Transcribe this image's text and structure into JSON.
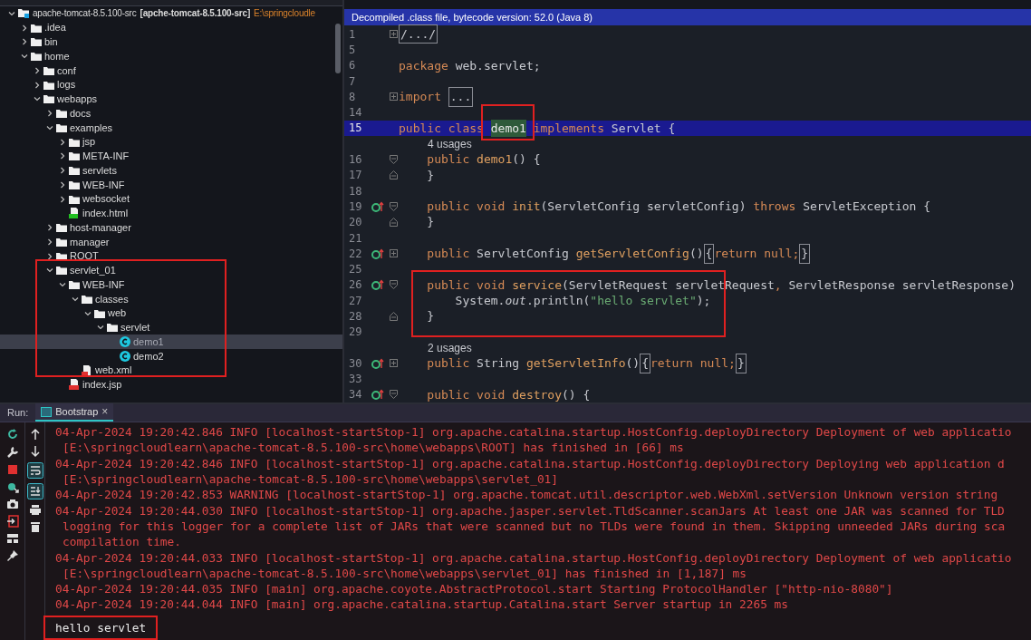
{
  "project_tree": {
    "label": "apache-tomcat-8.5.100-src",
    "module": "[apche-tomcat-8.5.100-src]",
    "path": "E:\\springcloudle",
    "kind": "module",
    "expanded": true,
    "selected": false,
    "children": [
      {
        "label": ".idea",
        "kind": "folder",
        "expanded": false,
        "selected": false
      },
      {
        "label": "bin",
        "kind": "folder",
        "expanded": false,
        "selected": false
      },
      {
        "label": "home",
        "kind": "folder",
        "expanded": true,
        "selected": false,
        "children": [
          {
            "label": "conf",
            "kind": "folder",
            "expanded": false,
            "selected": false
          },
          {
            "label": "logs",
            "kind": "folder",
            "expanded": false,
            "selected": false
          },
          {
            "label": "webapps",
            "kind": "folder",
            "expanded": true,
            "selected": false,
            "children": [
              {
                "label": "docs",
                "kind": "folder",
                "expanded": false,
                "selected": false
              },
              {
                "label": "examples",
                "kind": "folder",
                "expanded": true,
                "selected": false,
                "children": [
                  {
                    "label": "jsp",
                    "kind": "folder",
                    "expanded": false,
                    "selected": false
                  },
                  {
                    "label": "META-INF",
                    "kind": "folder",
                    "expanded": false,
                    "selected": false
                  },
                  {
                    "label": "servlets",
                    "kind": "folder",
                    "expanded": false,
                    "selected": false
                  },
                  {
                    "label": "WEB-INF",
                    "kind": "folder",
                    "expanded": false,
                    "selected": false
                  },
                  {
                    "label": "websocket",
                    "kind": "folder",
                    "expanded": false,
                    "selected": false
                  },
                  {
                    "label": "index.html",
                    "kind": "html",
                    "selected": false
                  }
                ]
              },
              {
                "label": "host-manager",
                "kind": "folder",
                "expanded": false,
                "selected": false
              },
              {
                "label": "manager",
                "kind": "folder",
                "expanded": false,
                "selected": false
              },
              {
                "label": "ROOT",
                "kind": "folder",
                "expanded": false,
                "selected": false
              },
              {
                "label": "servlet_01",
                "kind": "folder",
                "expanded": true,
                "selected": false,
                "children": [
                  {
                    "label": "WEB-INF",
                    "kind": "folder",
                    "expanded": true,
                    "selected": false,
                    "children": [
                      {
                        "label": "classes",
                        "kind": "folder",
                        "expanded": true,
                        "selected": false,
                        "children": [
                          {
                            "label": "web",
                            "kind": "folder",
                            "expanded": true,
                            "selected": false,
                            "children": [
                              {
                                "label": "servlet",
                                "kind": "folder",
                                "expanded": true,
                                "selected": false,
                                "children": [
                                  {
                                    "label": "demo1",
                                    "kind": "class",
                                    "selected": true
                                  },
                                  {
                                    "label": "demo2",
                                    "kind": "class",
                                    "selected": false
                                  }
                                ]
                              }
                            ]
                          }
                        ]
                      },
                      {
                        "label": "web.xml",
                        "kind": "xml",
                        "selected": false
                      }
                    ]
                  },
                  {
                    "label": "index.jsp",
                    "kind": "jsp",
                    "selected": false
                  }
                ]
              }
            ]
          }
        ]
      }
    ]
  },
  "editor": {
    "banner": "Decompiled .class file, bytecode version: 52.0 (Java 8)",
    "lines": [
      {
        "kind": "code",
        "number": "1",
        "folded": true,
        "segments": [
          {
            "text": "/.../",
            "kind": "fold"
          }
        ]
      },
      {
        "kind": "code",
        "number": "5"
      },
      {
        "kind": "code",
        "number": "6",
        "segments": [
          {
            "text": "package ",
            "kind": "kw"
          },
          {
            "text": "web.servlet;",
            "kind": "plain"
          }
        ]
      },
      {
        "kind": "code",
        "number": "7"
      },
      {
        "kind": "code",
        "number": "8",
        "folded": true,
        "segments": [
          {
            "text": "import ",
            "kind": "kw"
          },
          {
            "text": "...",
            "kind": "fold"
          }
        ]
      },
      {
        "kind": "code",
        "number": "14"
      },
      {
        "kind": "code",
        "number": "15",
        "selected": true,
        "segments": [
          {
            "text": "public class ",
            "kind": "kw"
          },
          {
            "text": "demo1",
            "kind": "match"
          },
          {
            "text": " implements ",
            "kind": "kw"
          },
          {
            "text": "Servlet {",
            "kind": "plain"
          }
        ]
      },
      {
        "kind": "usages",
        "text": "4 usages"
      },
      {
        "kind": "code",
        "number": "16",
        "fold_start": true,
        "segments": [
          {
            "text": "    public ",
            "kind": "kw"
          },
          {
            "text": "demo1",
            "kind": "fn"
          },
          {
            "text": "() {",
            "kind": "plain"
          }
        ]
      },
      {
        "kind": "code",
        "number": "17",
        "fold_end": true,
        "segments": [
          {
            "text": "    }",
            "kind": "plain"
          }
        ]
      },
      {
        "kind": "code",
        "number": "18"
      },
      {
        "kind": "code",
        "number": "19",
        "override": true,
        "fold_start": true,
        "segments": [
          {
            "text": "    public void ",
            "kind": "kw"
          },
          {
            "text": "init",
            "kind": "fn"
          },
          {
            "text": "(ServletConfig servletConfig) ",
            "kind": "plain"
          },
          {
            "text": "throws ",
            "kind": "kw"
          },
          {
            "text": "ServletException {",
            "kind": "plain"
          }
        ]
      },
      {
        "kind": "code",
        "number": "20",
        "fold_end": true,
        "segments": [
          {
            "text": "    }",
            "kind": "plain"
          }
        ]
      },
      {
        "kind": "code",
        "number": "21"
      },
      {
        "kind": "code",
        "number": "22",
        "override": true,
        "folded": true,
        "segments": [
          {
            "text": "    public ",
            "kind": "kw"
          },
          {
            "text": "ServletConfig ",
            "kind": "plain"
          },
          {
            "text": "getServletConfig",
            "kind": "fn"
          },
          {
            "text": "()",
            "kind": "plain"
          },
          {
            "text": "{",
            "kind": "fold"
          },
          {
            "text": "return null;",
            "kind": "kw"
          },
          {
            "text": "}",
            "kind": "fold"
          }
        ]
      },
      {
        "kind": "code",
        "number": "25"
      },
      {
        "kind": "code",
        "number": "26",
        "override": true,
        "fold_start": true,
        "segments": [
          {
            "text": "    public void ",
            "kind": "kw"
          },
          {
            "text": "service",
            "kind": "fn"
          },
          {
            "text": "(ServletRequest servletRequest",
            "kind": "plain"
          },
          {
            "text": ", ",
            "kind": "kw"
          },
          {
            "text": "ServletResponse servletResponse)",
            "kind": "plain"
          }
        ]
      },
      {
        "kind": "code",
        "number": "27",
        "segments": [
          {
            "text": "        System.",
            "kind": "plain"
          },
          {
            "text": "out",
            "kind": "italic"
          },
          {
            "text": ".println(",
            "kind": "plain"
          },
          {
            "text": "\"hello servlet\"",
            "kind": "str"
          },
          {
            "text": ");",
            "kind": "plain"
          }
        ]
      },
      {
        "kind": "code",
        "number": "28",
        "fold_end": true,
        "segments": [
          {
            "text": "    }",
            "kind": "plain"
          }
        ]
      },
      {
        "kind": "code",
        "number": "29"
      },
      {
        "kind": "usages",
        "text": "2 usages"
      },
      {
        "kind": "code",
        "number": "30",
        "override": true,
        "folded": true,
        "segments": [
          {
            "text": "    public ",
            "kind": "kw"
          },
          {
            "text": "String ",
            "kind": "plain"
          },
          {
            "text": "getServletInfo",
            "kind": "fn"
          },
          {
            "text": "()",
            "kind": "plain"
          },
          {
            "text": "{",
            "kind": "fold"
          },
          {
            "text": "return null;",
            "kind": "kw"
          },
          {
            "text": "}",
            "kind": "fold"
          }
        ]
      },
      {
        "kind": "code",
        "number": "33"
      },
      {
        "kind": "code",
        "number": "34",
        "override": true,
        "fold_start": true,
        "segments": [
          {
            "text": "    public void ",
            "kind": "kw"
          },
          {
            "text": "destroy",
            "kind": "fn"
          },
          {
            "text": "() {",
            "kind": "plain"
          }
        ]
      }
    ]
  },
  "run_panel": {
    "label": "Run:",
    "tabs": [
      {
        "label": "Bootstrap",
        "close": "×",
        "selected": true
      }
    ],
    "console": [
      {
        "kind": "log",
        "continuation": false,
        "text": "04-Apr-2024 19:20:42.846 INFO [localhost-startStop-1] org.apache.catalina.startup.HostConfig.deployDirectory Deployment of web applicatio"
      },
      {
        "kind": "log",
        "continuation": true,
        "text": "[E:\\springcloudlearn\\apache-tomcat-8.5.100-src\\home\\webapps\\ROOT] has finished in [66] ms"
      },
      {
        "kind": "log",
        "continuation": false,
        "text": "04-Apr-2024 19:20:42.846 INFO [localhost-startStop-1] org.apache.catalina.startup.HostConfig.deployDirectory Deploying web application d"
      },
      {
        "kind": "log",
        "continuation": true,
        "text": "[E:\\springcloudlearn\\apache-tomcat-8.5.100-src\\home\\webapps\\servlet_01]"
      },
      {
        "kind": "log",
        "continuation": false,
        "text": "04-Apr-2024 19:20:42.853 WARNING [localhost-startStop-1] org.apache.tomcat.util.descriptor.web.WebXml.setVersion Unknown version string"
      },
      {
        "kind": "log",
        "continuation": false,
        "text": "04-Apr-2024 19:20:44.030 INFO [localhost-startStop-1] org.apache.jasper.servlet.TldScanner.scanJars At least one JAR was scanned for TLD"
      },
      {
        "kind": "log",
        "continuation": true,
        "text": "logging for this logger for a complete list of JARs that were scanned but no TLDs were found in them. Skipping unneeded JARs during sca"
      },
      {
        "kind": "log",
        "continuation": true,
        "text": "compilation time."
      },
      {
        "kind": "log",
        "continuation": false,
        "text": "04-Apr-2024 19:20:44.033 INFO [localhost-startStop-1] org.apache.catalina.startup.HostConfig.deployDirectory Deployment of web applicatio"
      },
      {
        "kind": "log",
        "continuation": true,
        "text": "[E:\\springcloudlearn\\apache-tomcat-8.5.100-src\\home\\webapps\\servlet_01] has finished in [1,187] ms"
      },
      {
        "kind": "log",
        "continuation": false,
        "text": "04-Apr-2024 19:20:44.035 INFO [main] org.apache.coyote.AbstractProtocol.start Starting ProtocolHandler [\"http-nio-8080\"]"
      },
      {
        "kind": "log",
        "continuation": false,
        "text": "04-Apr-2024 19:20:44.044 INFO [main] org.apache.catalina.startup.Catalina.start Server startup in 2265 ms"
      },
      {
        "kind": "output",
        "continuation": false,
        "text": "hello servlet"
      }
    ]
  }
}
